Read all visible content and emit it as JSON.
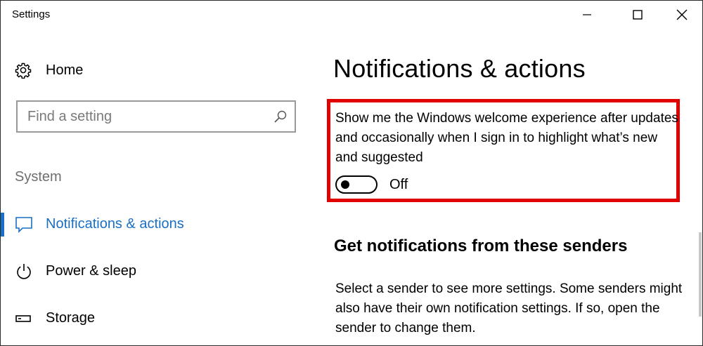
{
  "window": {
    "title": "Settings",
    "controls": {
      "minimize": "minimize",
      "maximize": "maximize",
      "close": "close"
    }
  },
  "sidebar": {
    "home_label": "Home",
    "search": {
      "placeholder": "Find a setting",
      "value": ""
    },
    "group_label": "System",
    "items": [
      {
        "label": "Notifications & actions",
        "icon": "chat-bubble-icon",
        "active": true
      },
      {
        "label": "Power & sleep",
        "icon": "power-icon",
        "active": false
      },
      {
        "label": "Storage",
        "icon": "storage-icon",
        "active": false
      }
    ]
  },
  "main": {
    "title": "Notifications & actions",
    "welcome_setting": {
      "description": "Show me the Windows welcome experience after updates and occasionally when I sign in to highlight what’s new and suggested",
      "state": "Off",
      "enabled": false
    },
    "senders": {
      "heading": "Get notifications from these senders",
      "description": "Select a sender to see more settings. Some senders might also have their own notification settings. If so, open the sender to change them."
    }
  },
  "colors": {
    "accent": "#1a6fc4",
    "highlight_border": "#e00000",
    "muted_text": "#6e6e6e"
  }
}
